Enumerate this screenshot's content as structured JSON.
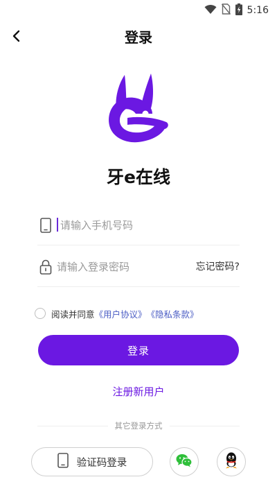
{
  "status_bar": {
    "time": "5:16",
    "icons": [
      "wifi-icon",
      "no-sim-icon",
      "battery-charging-icon"
    ]
  },
  "header": {
    "title": "登录",
    "back_icon": "chevron-left-icon"
  },
  "app": {
    "name": "牙e在线",
    "logo_icon": "rabbit-logo-icon",
    "brand_color": "#6b18e2"
  },
  "form": {
    "phone_placeholder": "请输入手机号码",
    "phone_value": "",
    "phone_icon": "phone-icon",
    "password_placeholder": "请输入登录密码",
    "password_value": "",
    "password_icon": "lock-icon",
    "forgot_label": "忘记密码?"
  },
  "agreement": {
    "checked": false,
    "prefix": "阅读并同意",
    "user_agreement": "《用户协议》",
    "privacy_policy": "《隐私条款》"
  },
  "login_button": "登录",
  "register_link": "注册新用户",
  "other_login": {
    "title": "其它登录方式",
    "sms_login_label": "验证码登录",
    "sms_icon": "phone-icon",
    "wechat_icon": "wechat-icon",
    "qq_icon": "qq-icon"
  }
}
